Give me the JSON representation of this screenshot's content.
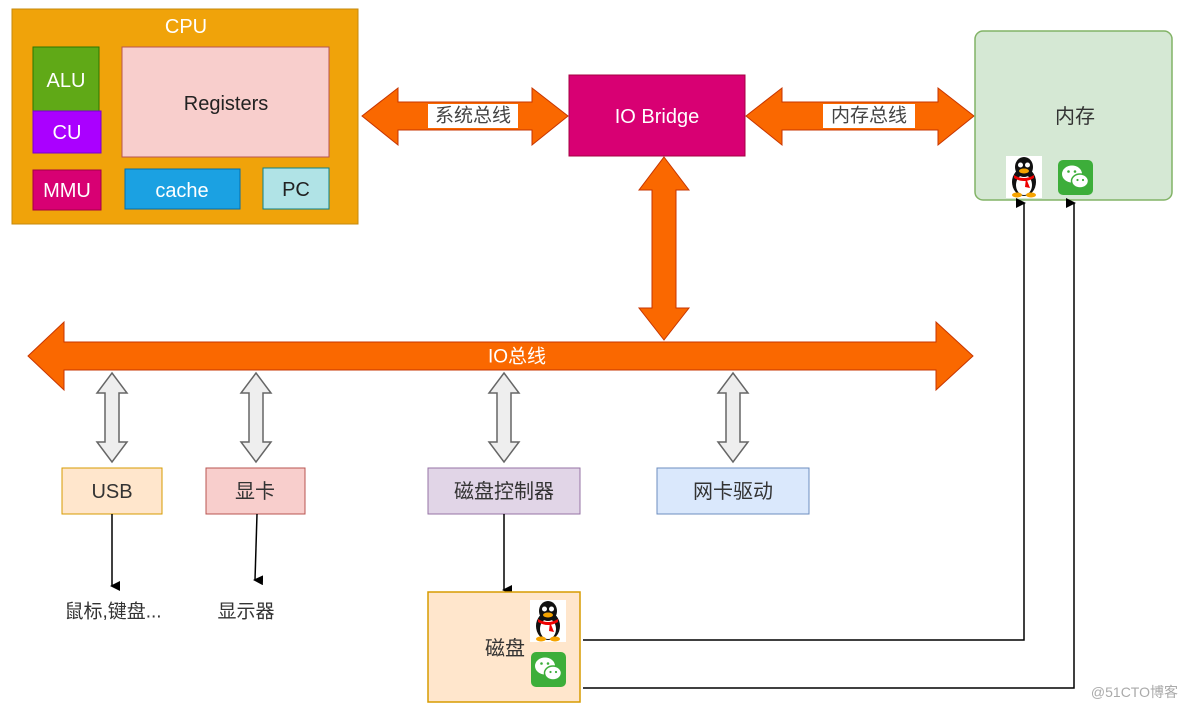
{
  "cpu": {
    "title": "CPU",
    "alu": "ALU",
    "cu": "CU",
    "registers": "Registers",
    "mmu": "MMU",
    "cache": "cache",
    "pc": "PC"
  },
  "system_bus": "系统总线",
  "io_bridge": "IO Bridge",
  "memory_bus": "内存总线",
  "memory": {
    "label": "内存",
    "icons": [
      "qq-penguin-icon",
      "wechat-icon"
    ]
  },
  "io_bus": "IO总线",
  "devices": {
    "usb": "USB",
    "gpu": "显卡",
    "disk_controller": "磁盘控制器",
    "nic_driver": "网卡驱动"
  },
  "outputs": {
    "usb": "鼠标,键盘...",
    "gpu": "显示器"
  },
  "disk": {
    "label": "磁盘",
    "icons": [
      "qq-penguin-icon",
      "wechat-icon"
    ]
  },
  "watermark": "@51CTO博客",
  "colors": {
    "cpu": "#f0a30a",
    "alu": "#60a917",
    "cu": "#aa00ff",
    "registers": "#f8cecc",
    "mmu": "#d80073",
    "cache": "#1ba1e2",
    "pc": "#b0e3e6",
    "io_bridge": "#d80073",
    "bus_arrow": "#fa6800",
    "memory": "#d5e8d4",
    "usb": "#ffe6cc",
    "gpu": "#f8cecc",
    "disk_controller": "#e1d5e7",
    "nic_driver": "#dae8fc",
    "disk": "#ffe6cc"
  }
}
